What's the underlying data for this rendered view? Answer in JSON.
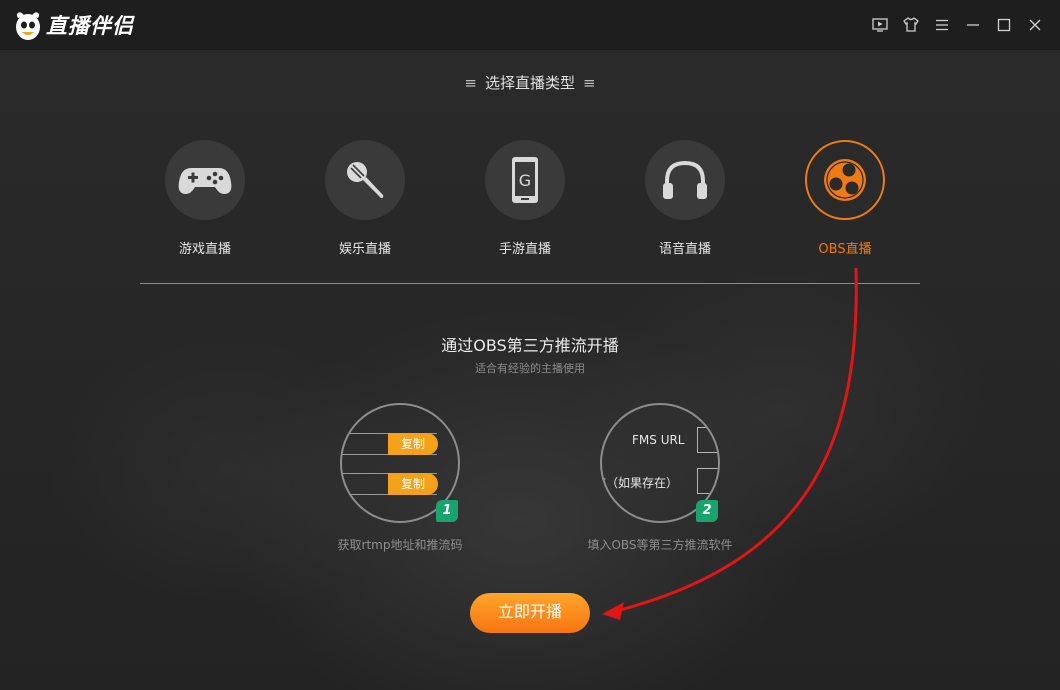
{
  "app": {
    "title": "直播伴侣"
  },
  "window_controls": [
    "play-icon",
    "shirt-icon",
    "menu-icon",
    "minimize-icon",
    "maximize-icon",
    "close-icon"
  ],
  "section": {
    "title": "选择直播类型",
    "decor": "≡"
  },
  "stream_types": [
    {
      "label": "游戏直播",
      "icon": "gamepad-icon",
      "active": false
    },
    {
      "label": "娱乐直播",
      "icon": "microphone-icon",
      "active": false
    },
    {
      "label": "手游直播",
      "icon": "phone-icon",
      "active": false
    },
    {
      "label": "语音直播",
      "icon": "headphones-icon",
      "active": false
    },
    {
      "label": "OBS直播",
      "icon": "obs-icon",
      "active": true
    }
  ],
  "phone_glyph": "G",
  "obs": {
    "heading": "通过OBS第三方推流开播",
    "subheading": "适合有经验的主播使用",
    "steps": [
      {
        "badge": "1",
        "caption": "获取rtmp地址和推流码",
        "copy_label": "复制"
      },
      {
        "badge": "2",
        "caption": "填入OBS等第三方推流软件",
        "field1": "FMS URL",
        "field2": "流（如果存在）"
      }
    ]
  },
  "start_button": {
    "label": "立即开播"
  },
  "colors": {
    "accent": "#f07b16",
    "badge_green": "#19a36d",
    "annotation_arrow": "#e01515"
  }
}
